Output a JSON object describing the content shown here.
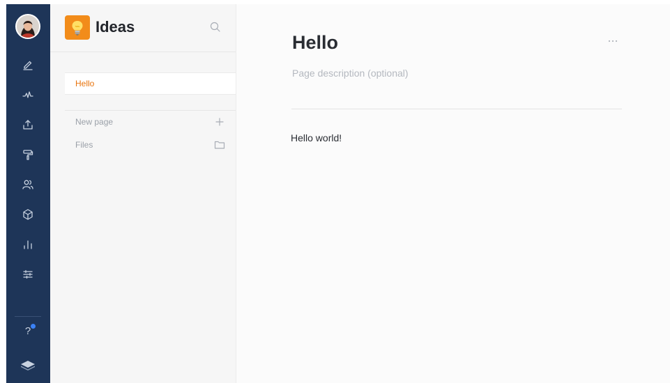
{
  "colors": {
    "rail_bg": "#1e3558",
    "accent_orange": "#e8730c",
    "logo_bg": "#f28c1a",
    "notification_blue": "#3b82f6"
  },
  "rail": {
    "avatar": "user-avatar",
    "icons": [
      "pencil-icon",
      "activity-icon",
      "upload-icon",
      "paint-roller-icon",
      "users-icon",
      "cube-icon",
      "bar-chart-icon",
      "sliders-icon",
      "help-icon",
      "book-icon"
    ],
    "help_label": "?"
  },
  "space": {
    "title": "Ideas",
    "logo_icon": "lightbulb-icon"
  },
  "pages": [
    {
      "label": "Hello",
      "active": true
    }
  ],
  "actions": {
    "new_page": "New page",
    "files": "Files"
  },
  "page": {
    "title": "Hello",
    "description_placeholder": "Page description (optional)",
    "description_value": "",
    "body": "Hello world!"
  }
}
